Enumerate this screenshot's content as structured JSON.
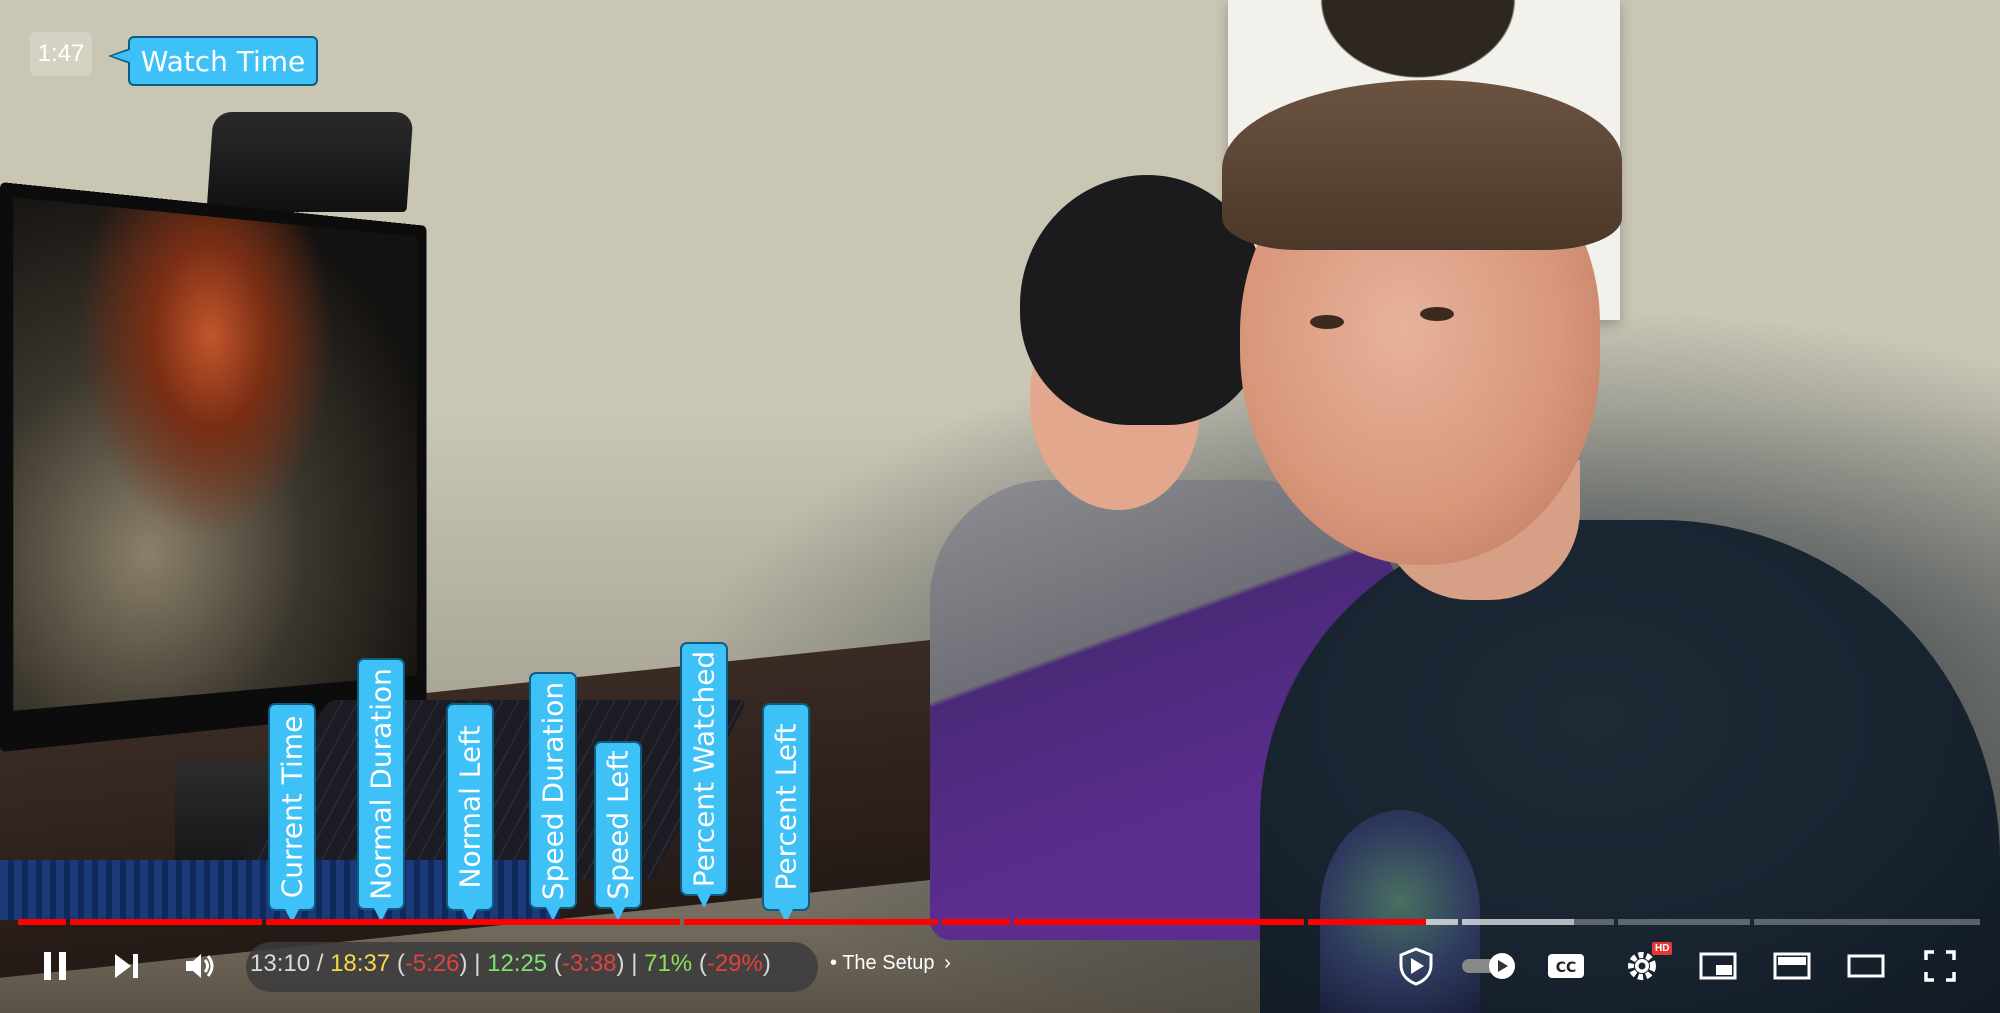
{
  "watch_time": {
    "value": "1:47",
    "label": "Watch Time"
  },
  "annotations": [
    "Current Time",
    "Normal Duration",
    "Normal Left",
    "Speed Duration",
    "Speed Left",
    "Percent Watched",
    "Percent Left"
  ],
  "time_display": {
    "current": "13:10",
    "sep1": "/",
    "normal_duration": "18:37",
    "normal_left": "-5:26",
    "speed_duration": "12:25",
    "speed_left": "-3:38",
    "percent_watched": "71%",
    "percent_left": "-29%"
  },
  "chapter": {
    "bullet": "•",
    "title": "The Setup"
  },
  "progress": {
    "played_fraction": 0.71
  },
  "controls": {
    "play_pause": "pause-icon",
    "next": "next-icon",
    "volume": "volume-icon",
    "badge_hd": "HD"
  },
  "colors": {
    "accent": "#ff0000",
    "callout": "#3ec1f7",
    "duration_yellow": "#f6d94a",
    "speed_green": "#7ce56f",
    "left_red": "#e0423f"
  }
}
